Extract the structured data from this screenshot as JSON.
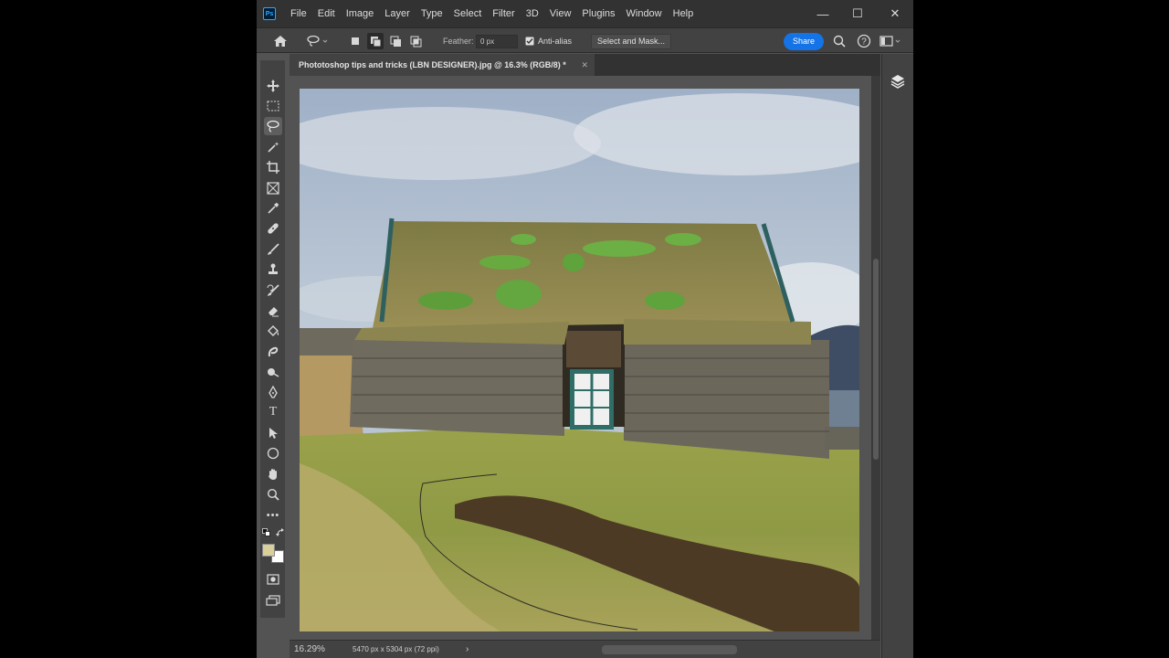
{
  "app": {
    "name": "Photoshop"
  },
  "menu": [
    "File",
    "Edit",
    "Image",
    "Layer",
    "Type",
    "Select",
    "Filter",
    "3D",
    "View",
    "Plugins",
    "Window",
    "Help"
  ],
  "window_controls": {
    "minimize": "—",
    "maximize": "☐",
    "close": "✕"
  },
  "options": {
    "feather_label": "Feather:",
    "feather_value": "0 px",
    "antialias_label": "Anti-alias",
    "antialias_checked": true,
    "select_mask_label": "Select and Mask...",
    "share_label": "Share"
  },
  "document": {
    "tab_title": "Phototoshop tips and tricks (LBN DESIGNER).jpg @ 16.3% (RGB/8) *",
    "close": "✕"
  },
  "status": {
    "zoom": "16.29%",
    "dimensions": "5470 px x 5304 px (72 ppi)",
    "arrow": "›"
  },
  "tools": [
    "move-tool",
    "marquee-tool",
    "lasso-tool",
    "magic-wand-tool",
    "crop-tool",
    "frame-tool",
    "eyedropper-tool",
    "healing-tool",
    "brush-tool",
    "clone-stamp-tool",
    "history-brush-tool",
    "eraser-tool",
    "paint-bucket-tool",
    "blur-tool",
    "dodge-tool",
    "pen-tool",
    "type-tool",
    "path-selection-tool",
    "ellipse-tool",
    "hand-tool",
    "zoom-tool",
    "more-tools"
  ],
  "colors": {
    "foreground": "#d8cf9a",
    "background": "#ffffff",
    "accent": "#1473e6"
  }
}
